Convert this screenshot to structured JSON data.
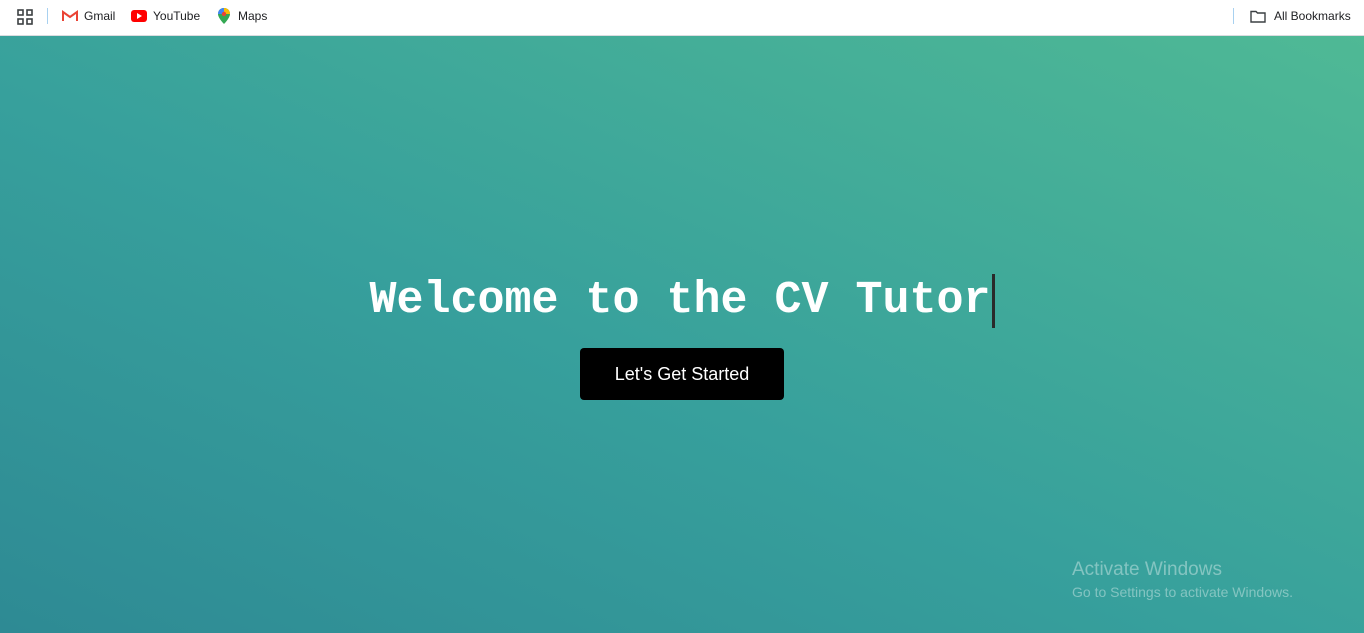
{
  "bookmarks_bar": {
    "apps_icon": "apps-grid-icon",
    "items": [
      {
        "label": "Gmail",
        "icon": "gmail-icon",
        "color": "#ea4335"
      },
      {
        "label": "YouTube",
        "icon": "youtube-icon",
        "color": "#ff0000"
      },
      {
        "label": "Maps",
        "icon": "maps-icon",
        "color": "#34a853"
      }
    ],
    "all_bookmarks": {
      "label": "All Bookmarks",
      "icon": "folder-icon"
    }
  },
  "hero": {
    "title": "Welcome to the CV Tutor",
    "cta_label": "Let's Get Started",
    "gradient_start": "#2e8a94",
    "gradient_end": "#4fb995",
    "button_color": "#000000"
  },
  "watermark": {
    "title": "Activate Windows",
    "subtitle": "Go to Settings to activate Windows."
  }
}
